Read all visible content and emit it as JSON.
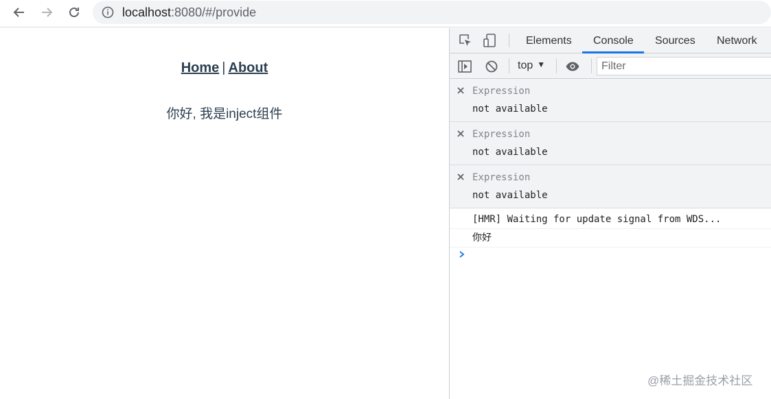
{
  "browser": {
    "url_host": "localhost",
    "url_path": ":8080/#/provide"
  },
  "page": {
    "nav": {
      "home": "Home",
      "separator": "|",
      "about": "About"
    },
    "greeting": "你好, 我是inject组件"
  },
  "devtools": {
    "tabs": [
      "Elements",
      "Console",
      "Sources",
      "Network"
    ],
    "active_tab": "Console",
    "context": "top",
    "filter_placeholder": "Filter",
    "expressions": [
      {
        "label": "Expression",
        "value": "not available"
      },
      {
        "label": "Expression",
        "value": "not available"
      },
      {
        "label": "Expression",
        "value": "not available"
      }
    ],
    "logs": [
      "[HMR] Waiting for update signal from WDS...",
      "你好"
    ],
    "accent": "#1a73e8"
  },
  "watermark": "@稀土掘金技术社区"
}
